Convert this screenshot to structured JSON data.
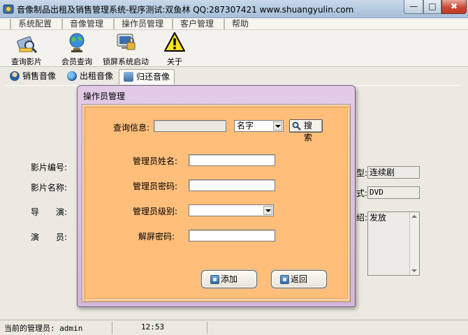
{
  "window": {
    "title": "音像制品出租及销售管理系统-程序测试:双鱼林 QQ:287307421 www.shuangyulin.com",
    "min_label": "—",
    "max_label": "□",
    "close_label": "✖"
  },
  "menu": [
    "系统配置",
    "音像管理",
    "操作员管理",
    "客户管理",
    "帮助"
  ],
  "toolbar": [
    {
      "label": "查询影片",
      "icon": "film-search-icon"
    },
    {
      "label": "会员查询",
      "icon": "globe-member-icon"
    },
    {
      "label": "锁屏系统启动",
      "icon": "lock-screen-icon"
    },
    {
      "label": "关于",
      "icon": "warning-about-icon"
    }
  ],
  "tabs": [
    {
      "label": "销售音像",
      "active": false
    },
    {
      "label": "出租音像",
      "active": false
    },
    {
      "label": "归还音像",
      "active": true
    }
  ],
  "background_form": {
    "labels": {
      "film_no": "影片编号:",
      "film_name": "影片名称:",
      "director": "导　　演:",
      "actor": "演　　员:"
    },
    "right_values": {
      "type": "连续剧",
      "format": "DVD",
      "intro": "发放"
    },
    "right_label_fragments": {
      "type": "型:",
      "format": "式:",
      "intro": "绍:"
    }
  },
  "status": {
    "admin_label": "当前的管理员: admin",
    "time": "12:53"
  },
  "dialog": {
    "title": "操作员管理",
    "query_label": "查询信息:",
    "query_value": "",
    "query_field": "名字",
    "search_button": "搜索",
    "name_label": "管理员姓名:",
    "name_value": "",
    "password_label": "管理员密码:",
    "password_value": "",
    "level_label": "管理员级别:",
    "level_value": "",
    "unlock_label": "解屏密码:",
    "unlock_value": "",
    "add_button": "添加",
    "back_button": "返回"
  },
  "colors": {
    "dialog_body": "#ffbe7a",
    "dialog_frame": "#d3b6d9",
    "titlebar": "#b3c8df",
    "close_button": "#c84a36"
  }
}
